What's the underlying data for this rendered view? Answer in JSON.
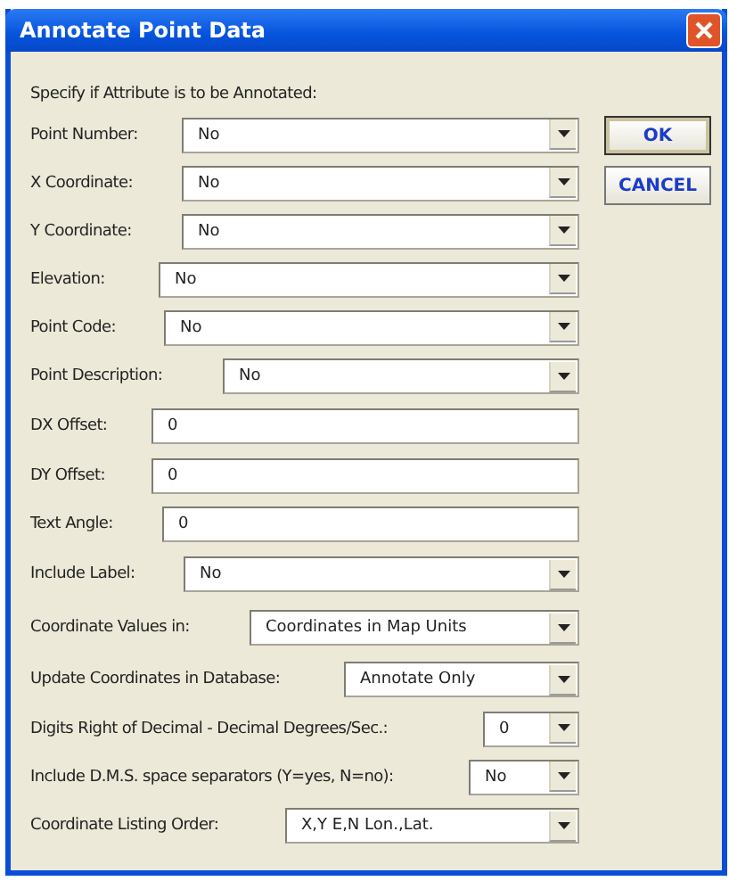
{
  "window": {
    "title": "Annotate Point Data"
  },
  "instruction": "Specify if Attribute is to be Annotated:",
  "fields": [
    {
      "kind": "combo",
      "label": "Point Number:",
      "value": "No"
    },
    {
      "kind": "combo",
      "label": "X Coordinate:",
      "value": "No"
    },
    {
      "kind": "combo",
      "label": "Y Coordinate:",
      "value": "No"
    },
    {
      "kind": "combo",
      "label": "Elevation:",
      "value": "No"
    },
    {
      "kind": "combo",
      "label": "Point Code:",
      "value": "No"
    },
    {
      "kind": "combo",
      "label": "Point Description:",
      "value": "No"
    },
    {
      "kind": "text",
      "label": "DX Offset:",
      "value": "0"
    },
    {
      "kind": "text",
      "label": "DY Offset:",
      "value": "0"
    },
    {
      "kind": "text",
      "label": "Text Angle:",
      "value": "0"
    },
    {
      "kind": "combo",
      "label": "Include Label:",
      "value": "No"
    },
    {
      "kind": "combo",
      "label": "Coordinate Values in:",
      "value": "Coordinates in Map Units"
    },
    {
      "kind": "combo",
      "label": "Update Coordinates in Database:",
      "value": "Annotate Only"
    },
    {
      "kind": "combo",
      "label": "Digits Right of Decimal - Decimal Degrees/Sec.:",
      "value": "0"
    },
    {
      "kind": "combo",
      "label": "Include D.M.S. space separators (Y=yes, N=no):",
      "value": "No"
    },
    {
      "kind": "combo",
      "label": "Coordinate Listing Order:",
      "value": "X,Y  E,N  Lon.,Lat."
    }
  ],
  "buttons": [
    {
      "label": "OK",
      "default": true
    },
    {
      "label": "CANCEL",
      "default": false
    }
  ]
}
